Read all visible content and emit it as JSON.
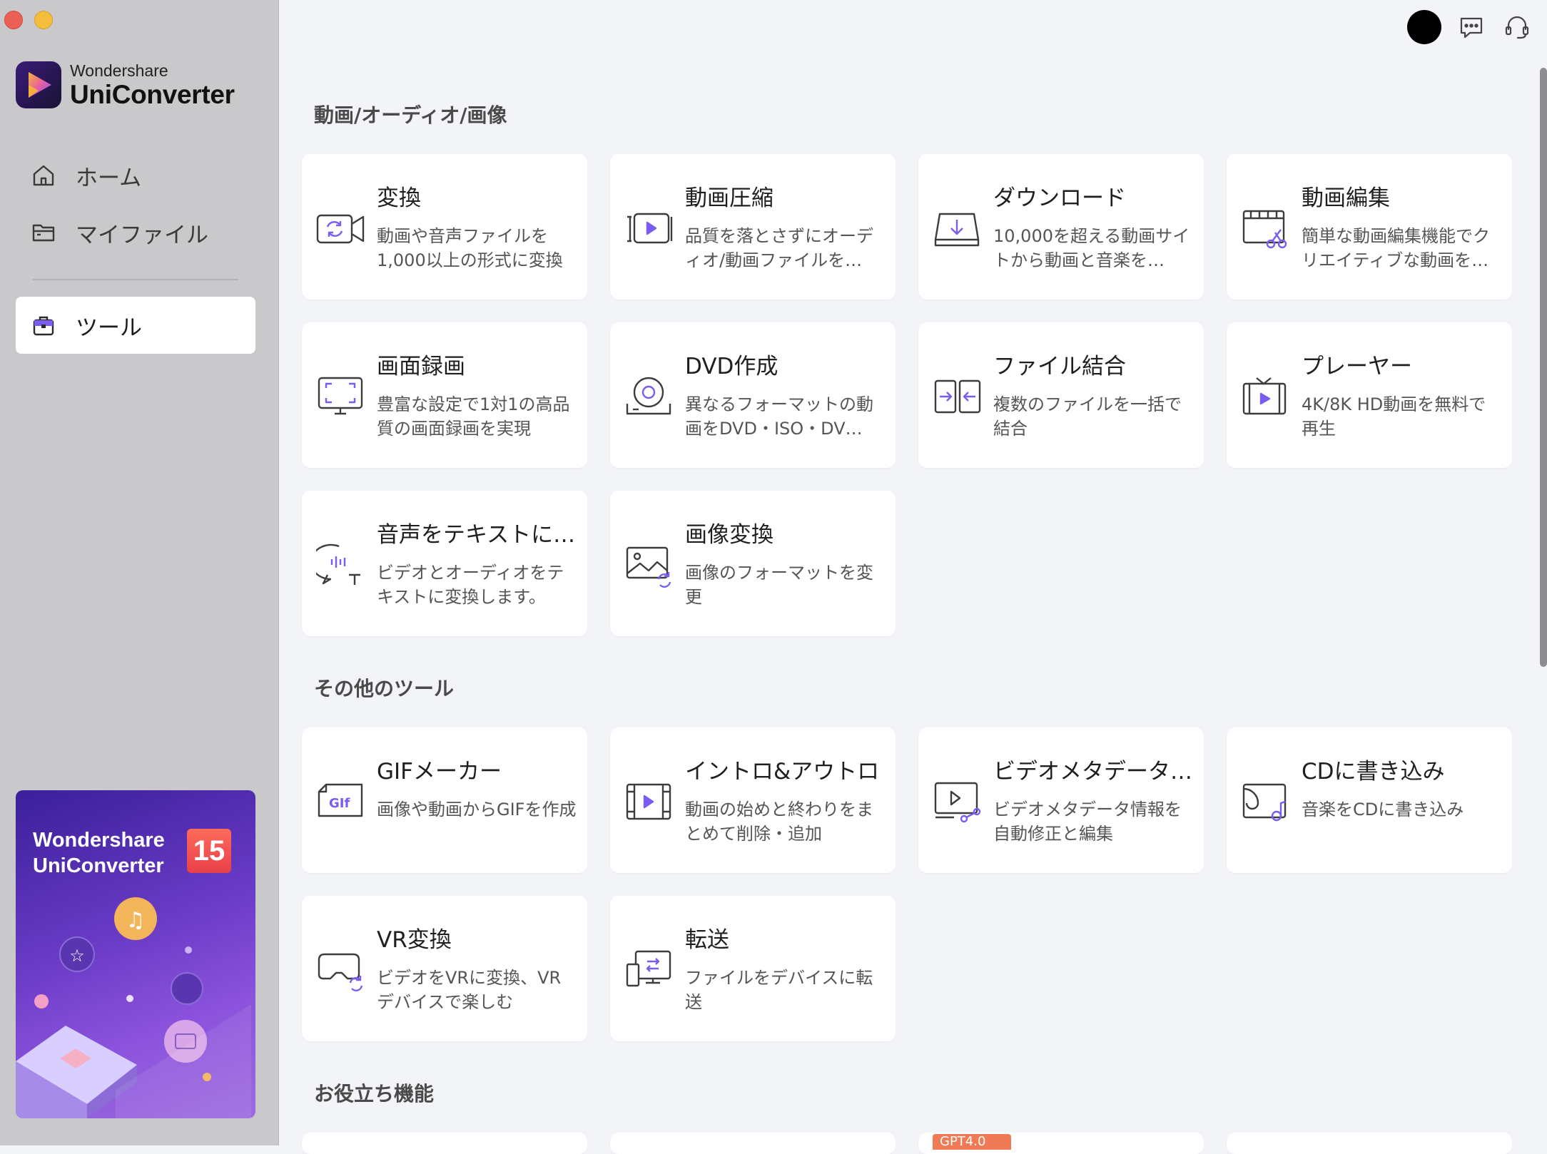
{
  "app": {
    "brand_small": "Wondershare",
    "brand_big": "UniConverter"
  },
  "sidebar": {
    "items": [
      {
        "label": "ホーム",
        "icon": "home-icon"
      },
      {
        "label": "マイファイル",
        "icon": "folder-icon"
      },
      {
        "label": "ツール",
        "icon": "toolbox-icon",
        "active": true
      }
    ],
    "promo": {
      "title": "Wondershare UniConverter",
      "version": "15"
    }
  },
  "sections": [
    {
      "title": "動画/オーディオ/画像",
      "cards": [
        {
          "title": "変換",
          "desc": "動画や音声ファイルを1,000以上の形式に変換",
          "icon": "convert-icon"
        },
        {
          "title": "動画圧縮",
          "desc": "品質を落とさずにオーディオ/動画ファイルを…",
          "icon": "compress-icon"
        },
        {
          "title": "ダウンロード",
          "desc": "10,000を超える動画サイトから動画と音楽を…",
          "icon": "download-icon"
        },
        {
          "title": "動画編集",
          "desc": "簡単な動画編集機能でクリエイティブな動画を…",
          "icon": "video-edit-icon"
        },
        {
          "title": "画面録画",
          "desc": "豊富な設定で1対1の高品質の画面録画を実現",
          "icon": "screen-record-icon"
        },
        {
          "title": "DVD作成",
          "desc": "異なるフォーマットの動画をDVD・ISO・DV…",
          "icon": "dvd-icon"
        },
        {
          "title": "ファイル結合",
          "desc": "複数のファイルを一括で結合",
          "icon": "merge-icon"
        },
        {
          "title": "プレーヤー",
          "desc": "4K/8K HD動画を無料で再生",
          "icon": "player-icon"
        },
        {
          "title": "音声をテキストに…",
          "desc": "ビデオとオーディオをテキストに変換します。",
          "icon": "speech-to-text-icon"
        },
        {
          "title": "画像変換",
          "desc": "画像のフォーマットを変更",
          "icon": "image-convert-icon"
        }
      ]
    },
    {
      "title": "その他のツール",
      "cards": [
        {
          "title": "GIFメーカー",
          "desc": "画像や動画からGIFを作成",
          "icon": "gif-icon"
        },
        {
          "title": "イントロ&アウトロ",
          "desc": "動画の始めと終わりをまとめて削除・追加",
          "icon": "intro-outro-icon"
        },
        {
          "title": "ビデオメタデータ…",
          "desc": "ビデオメタデータ情報を自動修正と編集",
          "icon": "metadata-icon"
        },
        {
          "title": "CDに書き込み",
          "desc": "音楽をCDに書き込み",
          "icon": "cd-burn-icon"
        },
        {
          "title": "VR変換",
          "desc": "ビデオをVRに変換、VRデバイスで楽しむ",
          "icon": "vr-icon"
        },
        {
          "title": "転送",
          "desc": "ファイルをデバイスに転送",
          "icon": "transfer-icon"
        }
      ]
    },
    {
      "title": "お役立ち機能",
      "badge": "GPT4.0"
    }
  ],
  "colors": {
    "accent": "#7b5cf0",
    "sidebar_bg": "#c9c9cb",
    "main_bg": "#f3f4f8"
  }
}
